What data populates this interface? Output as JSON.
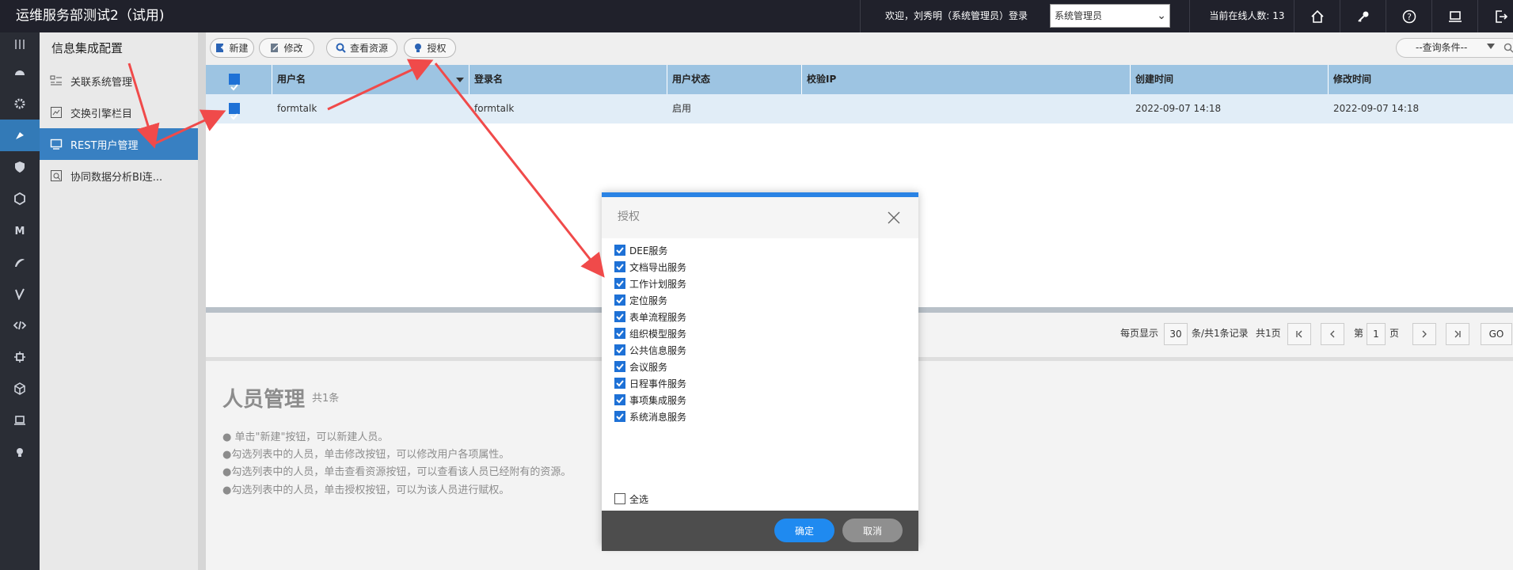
{
  "app": {
    "title": "运维服务部测试2（试用)"
  },
  "header": {
    "welcome": "欢迎，刘秀明（系统管理员）登录",
    "role_select": "系统管理员",
    "online": "当前在线人数: 13",
    "icons": [
      "home-icon",
      "key-icon",
      "help-icon",
      "monitor-icon",
      "logout-icon"
    ]
  },
  "leftnav": {
    "icons": [
      "grid-icon",
      "dashboard-icon",
      "gear-icon",
      "puzzle-icon",
      "shield-icon",
      "hexagon-icon",
      "m-icon",
      "leaf-icon",
      "v-icon",
      "code-icon",
      "chip-icon",
      "cube-icon",
      "laptop-icon",
      "bulb-icon"
    ],
    "active_index": 3
  },
  "submenu": {
    "title": "信息集成配置",
    "items": [
      {
        "label": "关联系统管理"
      },
      {
        "label": "交换引擎栏目"
      },
      {
        "label": "REST用户管理"
      },
      {
        "label": "协同数据分析BI连..."
      }
    ],
    "active_index": 2
  },
  "toolbar": {
    "new_label": "新建",
    "edit_label": "修改",
    "view_label": "查看资源",
    "grant_label": "授权",
    "query_placeholder": "--查询条件--"
  },
  "grid": {
    "columns": [
      "用户名",
      "登录名",
      "用户状态",
      "校验IP",
      "创建时间",
      "修改时间"
    ],
    "rows": [
      {
        "checked": true,
        "username": "formtalk",
        "login": "formtalk",
        "status": "启用",
        "ip": "",
        "created": "2022-09-07 14:18",
        "modified": "2022-09-07 14:18"
      }
    ]
  },
  "pager": {
    "per_page_label": "每页显示",
    "per_page": "30",
    "summary": "条/共1条记录",
    "total_pages": "共1页",
    "page_prefix": "第",
    "page": "1",
    "page_suffix": "页",
    "go_label": "GO"
  },
  "help": {
    "title": "人员管理",
    "count": "共1条",
    "lines": [
      "● 单击\"新建\"按钮，可以新建人员。",
      "●勾选列表中的人员，单击修改按钮，可以修改用户各项属性。",
      "●勾选列表中的人员，单击查看资源按钮，可以查看该人员已经附有的资源。",
      "●勾选列表中的人员，单击授权按钮，可以为该人员进行赋权。"
    ]
  },
  "dialog": {
    "title": "授权",
    "items": [
      {
        "label": "DEE服务",
        "checked": true
      },
      {
        "label": "文档导出服务",
        "checked": true
      },
      {
        "label": "工作计划服务",
        "checked": true
      },
      {
        "label": "定位服务",
        "checked": true
      },
      {
        "label": "表单流程服务",
        "checked": true
      },
      {
        "label": "组织模型服务",
        "checked": true
      },
      {
        "label": "公共信息服务",
        "checked": true
      },
      {
        "label": "会议服务",
        "checked": true
      },
      {
        "label": "日程事件服务",
        "checked": true
      },
      {
        "label": "事项集成服务",
        "checked": true
      },
      {
        "label": "系统消息服务",
        "checked": true
      }
    ],
    "select_all": {
      "label": "全选",
      "checked": false
    },
    "ok_label": "确定",
    "cancel_label": "取消"
  },
  "colors": {
    "accent": "#2a83e4",
    "active_nav": "#337ab7",
    "grid_header": "#9dc4e2",
    "annotation_arrow": "#f04a4a"
  }
}
